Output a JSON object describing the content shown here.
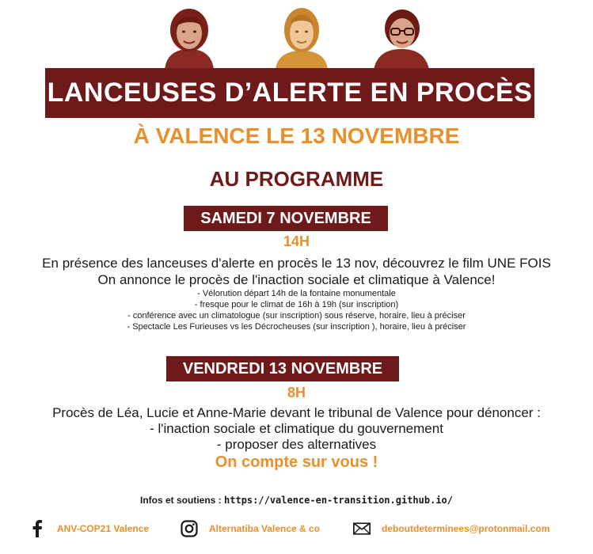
{
  "title": "LANCEUSES D’ALERTE EN PROCÈS",
  "subtitle": "À VALENCE LE 13 NOVEMBRE",
  "programme_heading": "AU PROGRAMME",
  "colors": {
    "banner": "#6f1a1a",
    "accent": "#e98f2b",
    "text": "#1a1a1a"
  },
  "day1": {
    "label": "SAMEDI 7 NOVEMBRE",
    "time": "14H",
    "line1": "En présence des lanceuses d'alerte en procès le 13 nov, découvrez le film UNE FOIS",
    "line2": "On annonce le procès de l'inaction sociale et climatique à Valence!",
    "items": [
      "- Vélorution départ 14h de la fontaine monumentale",
      "- fresque pour le climat de 16h à 19h (sur inscription)",
      "- conférence avec un climatologue (sur inscription) sous réserve, horaire, lieu à préciser",
      "- Spectacle Les Furieuses vs les Décrocheuses (sur inscription ), horaire, lieu à préciser"
    ]
  },
  "day2": {
    "label": "VENDREDI 13 NOVEMBRE",
    "time": "8H",
    "line1": "Procès de Léa, Lucie et Anne-Marie devant le tribunal de Valence pour dénoncer :",
    "items": [
      "- l'inaction sociale et climatique du gouvernement",
      "- proposer des alternatives"
    ]
  },
  "cta": "On compte sur vous !",
  "infos": {
    "label": "Infos et soutiens : ",
    "url": "https://valence-en-transition.github.io/"
  },
  "contacts": {
    "facebook": {
      "icon": "facebook-icon",
      "label": "ANV-COP21 Valence"
    },
    "instagram": {
      "icon": "instagram-icon",
      "label": "Alternatiba Valence & co"
    },
    "email": {
      "icon": "envelope-icon",
      "label": "deboutdeterminees@protonmail.com"
    }
  }
}
